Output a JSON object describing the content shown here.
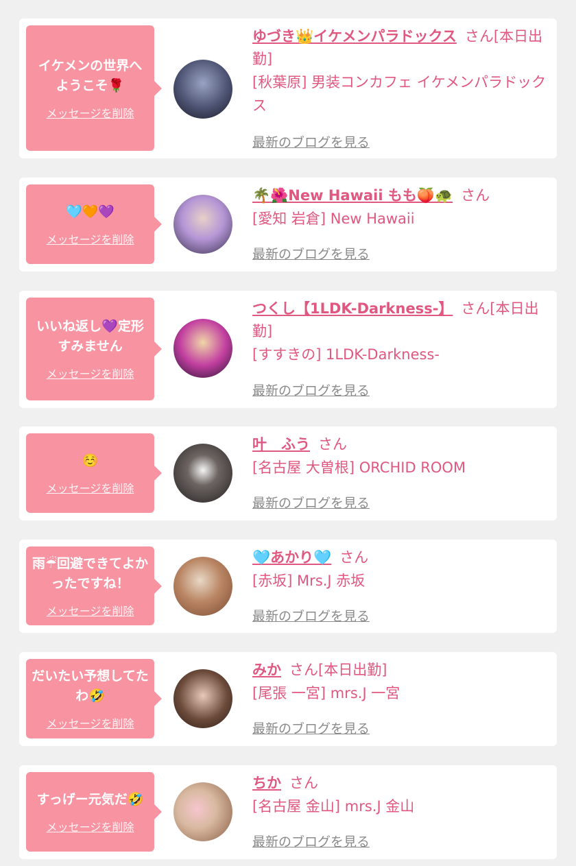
{
  "entries": [
    {
      "message": "イケメンの世界へようこそ🌹",
      "delete_label": "メッセージを削除",
      "name": "ゆづき👑イケメンパラドックス",
      "suffix": "さん[本日出勤]",
      "shop": "[秋葉原] 男装コンカフェ イケメンパラドックス",
      "blog_label": "最新のブログを見る",
      "avatar_colors": [
        "#9aa3c4",
        "#1b1b24"
      ]
    },
    {
      "message": "🩵🧡💜",
      "delete_label": "メッセージを削除",
      "name": "🌴🌺New Hawaii もも🍑🐢",
      "suffix": "さん",
      "shop": "[愛知 岩倉] New Hawaii",
      "blog_label": "最新のブログを見る",
      "avatar_colors": [
        "#b596d6",
        "#3a3150"
      ]
    },
    {
      "message": "いいね返し💜定形すみません",
      "delete_label": "メッセージを削除",
      "name": "つくし【1LDK-Darkness-】",
      "suffix": "さん[本日出勤]",
      "shop": "[すすきの] 1LDK-Darkness-",
      "blog_label": "最新のブログを見る",
      "avatar_colors": [
        "#c23fa0",
        "#241330"
      ]
    },
    {
      "message": "☺️",
      "delete_label": "メッセージを削除",
      "name": "叶　ふう",
      "suffix": "さん",
      "shop": "[名古屋 大曽根] ORCHID ROOM",
      "blog_label": "最新のブログを見る",
      "avatar_colors": [
        "#6d6562",
        "#232020"
      ]
    },
    {
      "message": "雨☔回避できてよかったですね！",
      "delete_label": "メッセージを削除",
      "name": "🩵あかり🩵",
      "suffix": "さん",
      "shop": "[赤坂] Mrs.J 赤坂",
      "blog_label": "最新のブログを見る",
      "avatar_colors": [
        "#d9c8b8",
        "#7a4a33"
      ]
    },
    {
      "message": "だいたい予想してたわ🤣",
      "delete_label": "メッセージを削除",
      "name": "みか",
      "suffix": "さん[本日出勤]",
      "shop": "[尾張 一宮] mrs.J 一宮",
      "blog_label": "最新のブログを見る",
      "avatar_colors": [
        "#6b4a3a",
        "#2a1c16"
      ]
    },
    {
      "message": "すっげー元気だ🤣",
      "delete_label": "メッセージを削除",
      "name": "ちか",
      "suffix": "さん",
      "shop": "[名古屋 金山] mrs.J 金山",
      "blog_label": "最新のブログを見る",
      "avatar_colors": [
        "#d8b9a0",
        "#8a5c45"
      ]
    }
  ]
}
